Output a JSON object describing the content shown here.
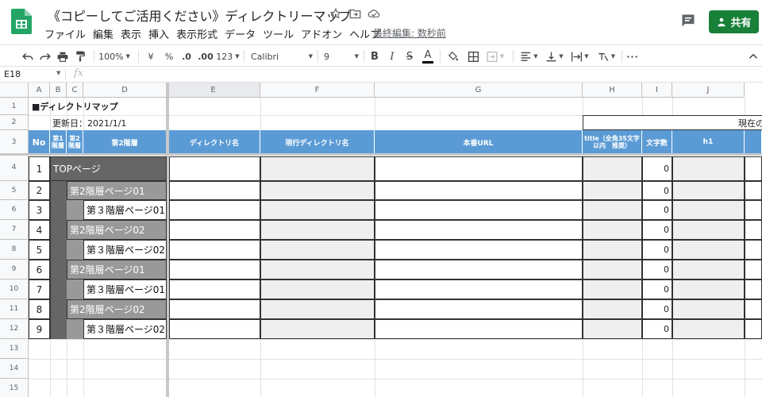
{
  "app": {
    "doc_title": "《コピーしてご活用ください》ディレクトリーマップ",
    "menu": [
      "ファイル",
      "編集",
      "表示",
      "挿入",
      "表示形式",
      "データ",
      "ツール",
      "アドオン",
      "ヘルプ"
    ],
    "last_edit": "最終編集: 数秒前",
    "share_label": "共有"
  },
  "toolbar": {
    "zoom": "100%",
    "currency": "¥",
    "percent": "%",
    "dec_decrease": ".0",
    "dec_increase": ".00",
    "more_formats": "123",
    "font": "Calibri",
    "font_size": "9",
    "bold": "B",
    "italic": "I",
    "strike": "S",
    "text_color": "A"
  },
  "formula_bar": {
    "cell_ref": "E18",
    "fx": "fx"
  },
  "columns": [
    "A",
    "B",
    "C",
    "D",
    "E",
    "F",
    "G",
    "H",
    "I",
    "J"
  ],
  "rows": [
    "1",
    "2",
    "3",
    "4",
    "5",
    "6",
    "7",
    "8",
    "9",
    "10",
    "11",
    "12",
    "13",
    "14",
    "15"
  ],
  "sheet": {
    "title": "■ディレクトリマップ",
    "updated": "更新日：2021/1/1",
    "current_label": "現在の",
    "headers": {
      "no": "No",
      "level1": "第1階層",
      "level2": "第2階層",
      "level2_main": "第2階層",
      "dir_name": "ディレクトリ名",
      "current_dir": "現行ディレクトリ名",
      "url": "本番URL",
      "title": "title（全角35文字以内　推奨）",
      "char_count": "文字数",
      "h1": "h1"
    },
    "data_rows": [
      {
        "no": "1",
        "page": "TOPページ",
        "level": 1,
        "count": "0"
      },
      {
        "no": "2",
        "page": "第2階層ページ01",
        "level": 2,
        "count": "0"
      },
      {
        "no": "3",
        "page": "第３階層ページ01",
        "level": 3,
        "count": "0"
      },
      {
        "no": "4",
        "page": "第2階層ページ02",
        "level": 2,
        "count": "0"
      },
      {
        "no": "5",
        "page": "第３階層ページ02",
        "level": 3,
        "count": "0"
      },
      {
        "no": "6",
        "page": "第2階層ページ01",
        "level": 2,
        "count": "0"
      },
      {
        "no": "7",
        "page": "第３階層ページ01",
        "level": 3,
        "count": "0"
      },
      {
        "no": "8",
        "page": "第2階層ページ02",
        "level": 2,
        "count": "0"
      },
      {
        "no": "9",
        "page": "第３階層ページ02",
        "level": 3,
        "count": "0"
      }
    ]
  },
  "colors": {
    "header_blue": "#5b9bd5",
    "level1_fill": "#666666",
    "level2_fill": "#999999",
    "share_green": "#188038"
  }
}
